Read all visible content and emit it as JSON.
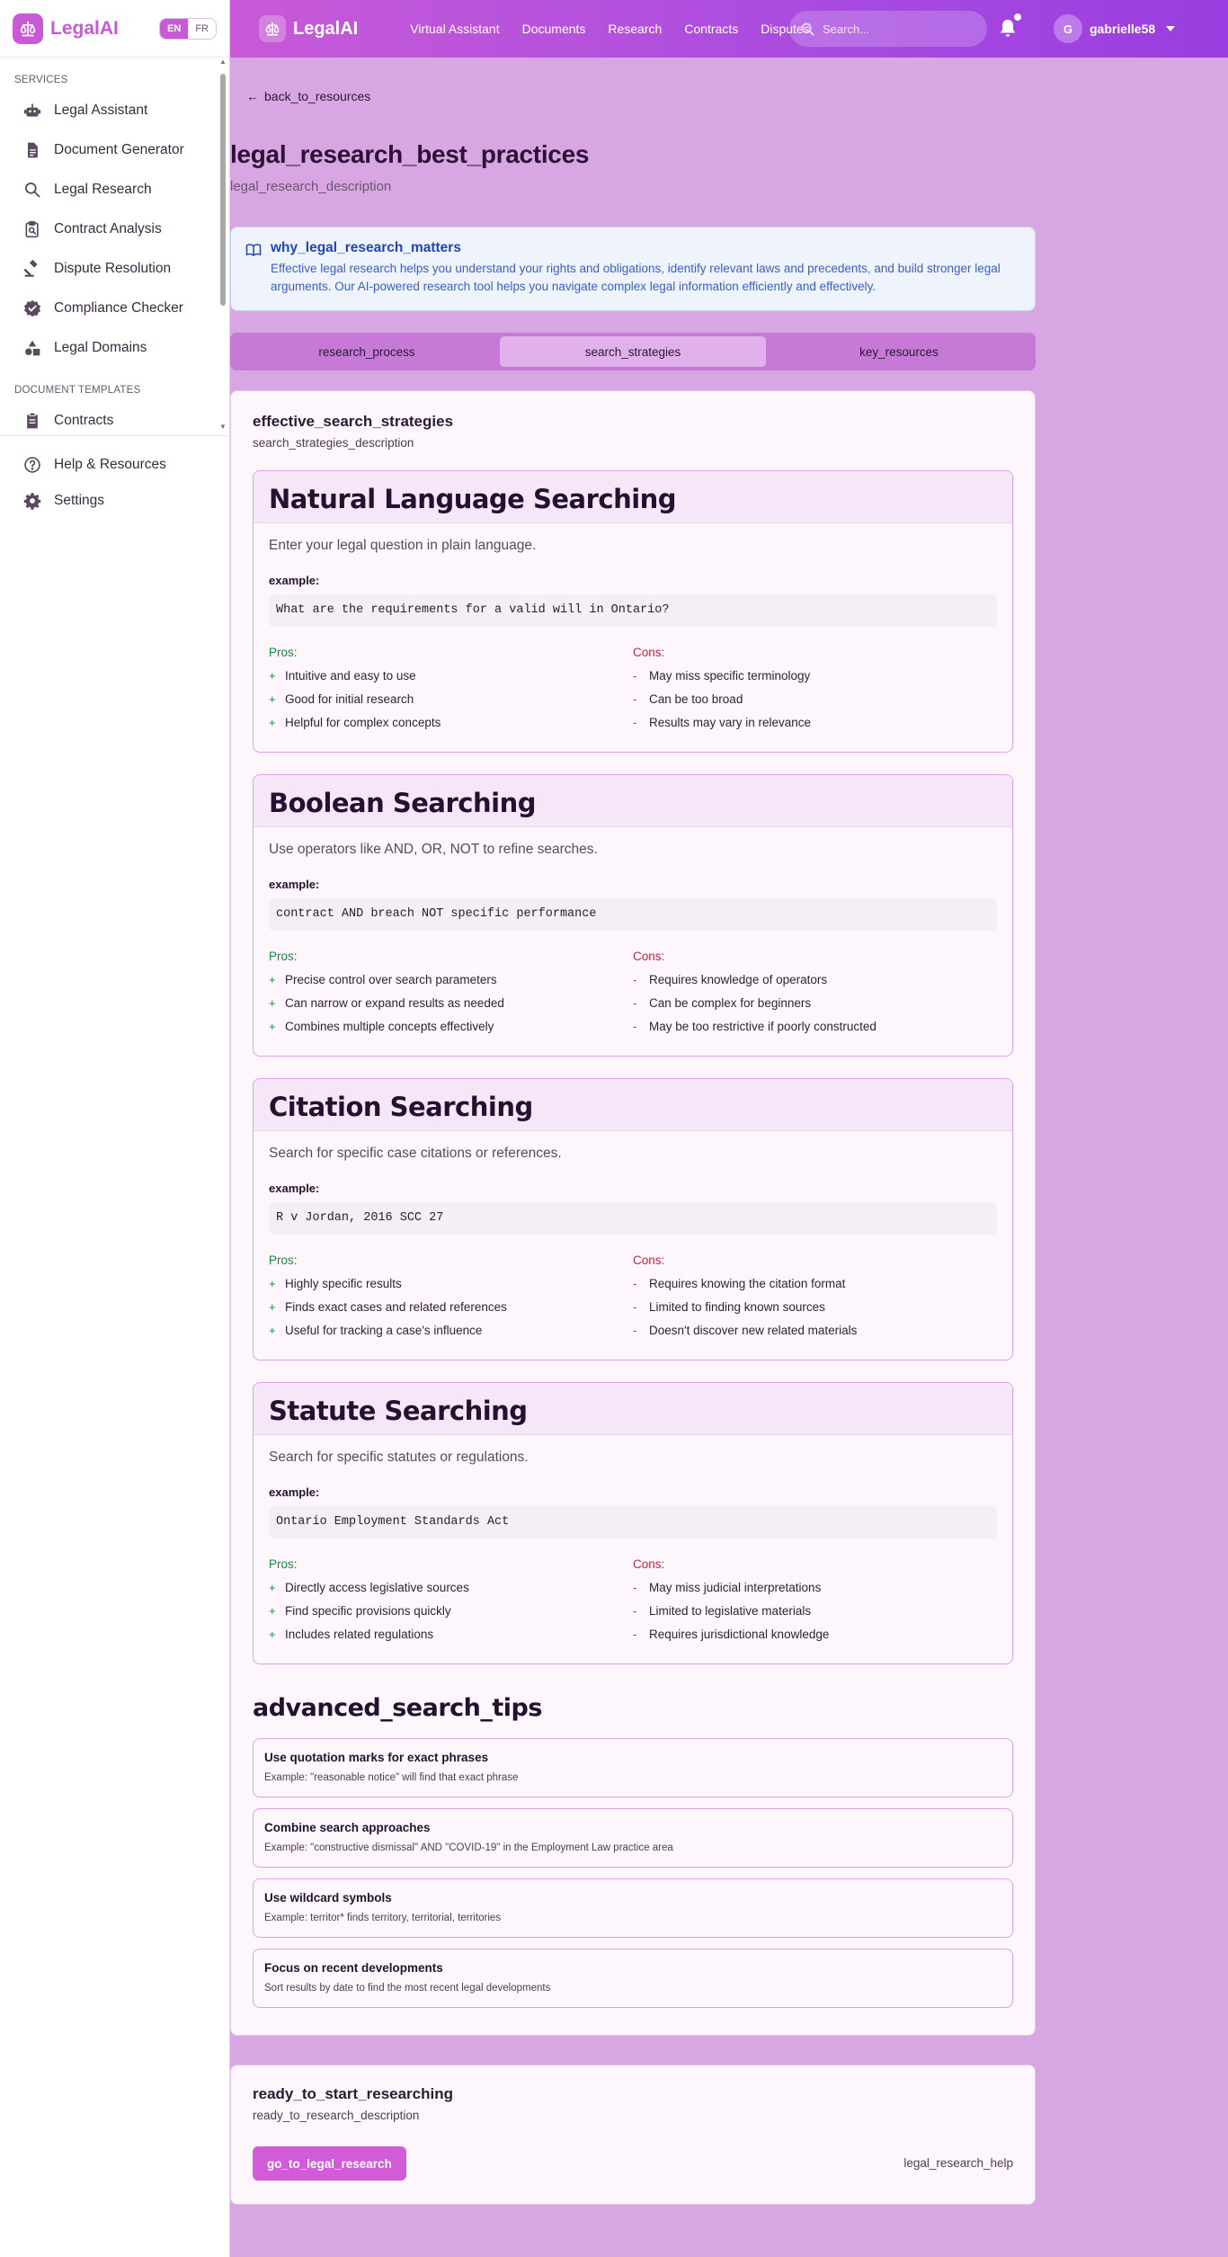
{
  "app": {
    "name": "LegalAI",
    "languages": [
      "EN",
      "FR"
    ],
    "active_language": "EN"
  },
  "sidebar": {
    "sections": [
      {
        "label": "SERVICES",
        "items": [
          {
            "label": "Legal Assistant",
            "icon": "robot-icon"
          },
          {
            "label": "Document Generator",
            "icon": "document-icon"
          },
          {
            "label": "Legal Research",
            "icon": "search-icon"
          },
          {
            "label": "Contract Analysis",
            "icon": "clipboard-search-icon"
          },
          {
            "label": "Dispute Resolution",
            "icon": "gavel-icon"
          },
          {
            "label": "Compliance Checker",
            "icon": "badge-check-icon"
          },
          {
            "label": "Legal Domains",
            "icon": "shapes-icon"
          }
        ]
      },
      {
        "label": "DOCUMENT TEMPLATES",
        "items": [
          {
            "label": "Contracts",
            "icon": "clipboard-icon"
          }
        ]
      }
    ],
    "bottom_items": [
      {
        "label": "Help & Resources",
        "icon": "help-circle-icon"
      },
      {
        "label": "Settings",
        "icon": "gear-icon"
      }
    ]
  },
  "topbar": {
    "title": "LegalAI",
    "nav": [
      "Virtual Assistant",
      "Documents",
      "Research",
      "Contracts",
      "Disputes"
    ],
    "search_placeholder": "Search...",
    "user": {
      "initial": "G",
      "name": "gabrielle58"
    }
  },
  "page": {
    "back_label": "back_to_resources",
    "title": "legal_research_best_practices",
    "description": "legal_research_description"
  },
  "info_box": {
    "title": "why_legal_research_matters",
    "text": "Effective legal research helps you understand your rights and obligations, identify relevant laws and precedents, and build stronger legal arguments. Our AI-powered research tool helps you navigate complex legal information efficiently and effectively."
  },
  "tabs": [
    {
      "label": "research_process",
      "active": false
    },
    {
      "label": "search_strategies",
      "active": true
    },
    {
      "label": "key_resources",
      "active": false
    }
  ],
  "strategies_card": {
    "title": "effective_search_strategies",
    "description": "search_strategies_description",
    "example_label": "example:",
    "pros_label": "Pros:",
    "cons_label": "Cons:",
    "strategies": [
      {
        "name": "Natural Language Searching",
        "description": "Enter your legal question in plain language.",
        "example": "What are the requirements for a valid will in Ontario?",
        "pros": [
          "Intuitive and easy to use",
          "Good for initial research",
          "Helpful for complex concepts"
        ],
        "cons": [
          "May miss specific terminology",
          "Can be too broad",
          "Results may vary in relevance"
        ]
      },
      {
        "name": "Boolean Searching",
        "description": "Use operators like AND, OR, NOT to refine searches.",
        "example": "contract AND breach NOT specific performance",
        "pros": [
          "Precise control over search parameters",
          "Can narrow or expand results as needed",
          "Combines multiple concepts effectively"
        ],
        "cons": [
          "Requires knowledge of operators",
          "Can be complex for beginners",
          "May be too restrictive if poorly constructed"
        ]
      },
      {
        "name": "Citation Searching",
        "description": "Search for specific case citations or references.",
        "example": "R v Jordan, 2016 SCC 27",
        "pros": [
          "Highly specific results",
          "Finds exact cases and related references",
          "Useful for tracking a case's influence"
        ],
        "cons": [
          "Requires knowing the citation format",
          "Limited to finding known sources",
          "Doesn't discover new related materials"
        ]
      },
      {
        "name": "Statute Searching",
        "description": "Search for specific statutes or regulations.",
        "example": "Ontario Employment Standards Act",
        "pros": [
          "Directly access legislative sources",
          "Find specific provisions quickly",
          "Includes related regulations"
        ],
        "cons": [
          "May miss judicial interpretations",
          "Limited to legislative materials",
          "Requires jurisdictional knowledge"
        ]
      }
    ],
    "advanced_title": "advanced_search_tips",
    "tips": [
      {
        "title": "Use quotation marks for exact phrases",
        "example": "Example: \"reasonable notice\" will find that exact phrase"
      },
      {
        "title": "Combine search approaches",
        "example": "Example: \"constructive dismissal\" AND \"COVID-19\" in the Employment Law practice area"
      },
      {
        "title": "Use wildcard symbols",
        "example": "Example: territor* finds territory, territorial, territories"
      },
      {
        "title": "Focus on recent developments",
        "example": "Sort results by date to find the most recent legal developments"
      }
    ]
  },
  "cta": {
    "title": "ready_to_start_researching",
    "description": "ready_to_research_description",
    "button_label": "go_to_legal_research",
    "help_text": "legal_research_help"
  },
  "colors": {
    "brand": "#c95ad6",
    "page_background": "#d8a6e3",
    "pros": "#1a8a3a",
    "cons": "#d21d3c",
    "info_text": "#2145b5"
  }
}
